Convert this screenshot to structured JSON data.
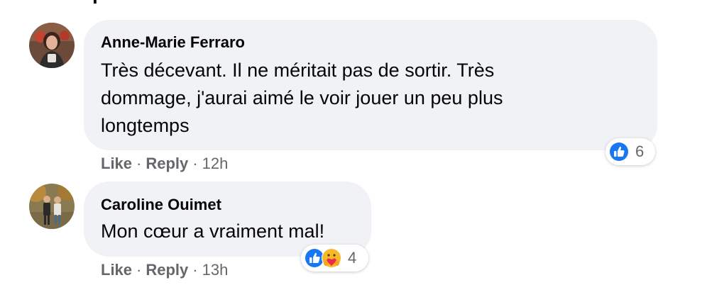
{
  "comments": [
    {
      "author": "Anne-Marie Ferraro",
      "text": "Très décevant. Il ne méritait pas de sortir. Très dommage, j'aurai aimé le voir jouer un peu plus longtemps",
      "like_label": "Like",
      "reply_label": "Reply",
      "separator": "·",
      "time": "12h",
      "reactions": {
        "icons": [
          "like-icon"
        ],
        "count": "6"
      }
    },
    {
      "author": "Caroline Ouimet",
      "text": "Mon cœur a vraiment mal!",
      "like_label": "Like",
      "reply_label": "Reply",
      "separator": "·",
      "time": "13h",
      "reactions": {
        "icons": [
          "like-icon",
          "care-icon"
        ],
        "count": "4"
      }
    }
  ],
  "colors": {
    "bubble_bg": "#f0f2f5",
    "meta_text": "#65676b",
    "like_blue": "#1877f2",
    "care_yellow": "#f7b928"
  }
}
